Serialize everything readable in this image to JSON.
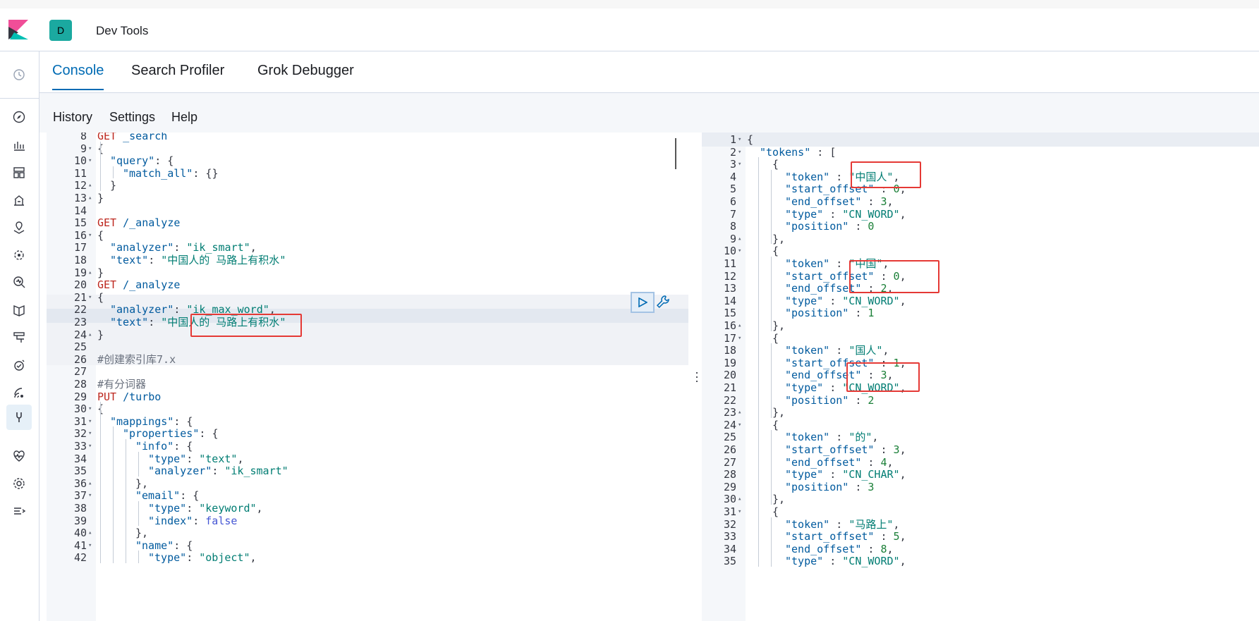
{
  "app": {
    "title": "Dev Tools",
    "space_initial": "D"
  },
  "tabs": [
    {
      "label": "Console",
      "active": true
    },
    {
      "label": "Search Profiler",
      "active": false
    },
    {
      "label": "Grok Debugger",
      "active": false
    }
  ],
  "menu": {
    "history": "History",
    "settings": "Settings",
    "help": "Help"
  },
  "sidebar_icons": [
    "clock-icon",
    "compass-icon",
    "visualize-icon",
    "dashboard-icon",
    "canvas-icon",
    "maps-icon",
    "ml-icon",
    "metrics-icon",
    "logs-icon",
    "apm-icon",
    "uptime-icon",
    "siem-icon",
    "dev-tools-icon",
    "monitoring-icon",
    "management-icon",
    "collapse-icon"
  ],
  "request_lines": [
    {
      "n": "8",
      "fold": "",
      "indent": 0,
      "text": "GET _search"
    },
    {
      "n": "9",
      "fold": "▾",
      "indent": 0,
      "text": "{"
    },
    {
      "n": "10",
      "fold": "▾",
      "indent": 1,
      "text": "\"query\": {"
    },
    {
      "n": "11",
      "fold": "",
      "indent": 2,
      "text": "\"match_all\": {}"
    },
    {
      "n": "12",
      "fold": "▴",
      "indent": 1,
      "text": "}"
    },
    {
      "n": "13",
      "fold": "▴",
      "indent": 0,
      "text": "}"
    },
    {
      "n": "14",
      "fold": "",
      "indent": 0,
      "text": ""
    },
    {
      "n": "15",
      "fold": "",
      "indent": 0,
      "text": "GET /_analyze"
    },
    {
      "n": "16",
      "fold": "▾",
      "indent": 0,
      "text": "{"
    },
    {
      "n": "17",
      "fold": "",
      "indent": 1,
      "text": "\"analyzer\": \"ik_smart\","
    },
    {
      "n": "18",
      "fold": "",
      "indent": 1,
      "text": "\"text\": \"中国人的 马路上有积水\""
    },
    {
      "n": "19",
      "fold": "▴",
      "indent": 0,
      "text": "}"
    },
    {
      "n": "20",
      "fold": "",
      "indent": 0,
      "text": "GET /_analyze"
    },
    {
      "n": "21",
      "fold": "▾",
      "indent": 0,
      "text": "{"
    },
    {
      "n": "22",
      "fold": "",
      "indent": 1,
      "text": "\"analyzer\": \"ik_max_word\","
    },
    {
      "n": "23",
      "fold": "",
      "indent": 1,
      "text": "\"text\": \"中国人的 马路上有积水\""
    },
    {
      "n": "24",
      "fold": "▴",
      "indent": 0,
      "text": "}"
    },
    {
      "n": "25",
      "fold": "",
      "indent": 0,
      "text": ""
    },
    {
      "n": "26",
      "fold": "",
      "indent": 0,
      "text": "#创建索引库7.x"
    },
    {
      "n": "27",
      "fold": "",
      "indent": 0,
      "text": ""
    },
    {
      "n": "28",
      "fold": "",
      "indent": 0,
      "text": "#有分词器"
    },
    {
      "n": "29",
      "fold": "",
      "indent": 0,
      "text": "PUT /turbo"
    },
    {
      "n": "30",
      "fold": "▾",
      "indent": 0,
      "text": "{"
    },
    {
      "n": "31",
      "fold": "▾",
      "indent": 1,
      "text": "\"mappings\": {"
    },
    {
      "n": "32",
      "fold": "▾",
      "indent": 2,
      "text": "\"properties\": {"
    },
    {
      "n": "33",
      "fold": "▾",
      "indent": 3,
      "text": "\"info\": {"
    },
    {
      "n": "34",
      "fold": "",
      "indent": 4,
      "text": "\"type\": \"text\","
    },
    {
      "n": "35",
      "fold": "",
      "indent": 4,
      "text": "\"analyzer\": \"ik_smart\""
    },
    {
      "n": "36",
      "fold": "▴",
      "indent": 3,
      "text": "},"
    },
    {
      "n": "37",
      "fold": "▾",
      "indent": 3,
      "text": "\"email\": {"
    },
    {
      "n": "38",
      "fold": "",
      "indent": 4,
      "text": "\"type\": \"keyword\","
    },
    {
      "n": "39",
      "fold": "",
      "indent": 4,
      "text": "\"index\": false"
    },
    {
      "n": "40",
      "fold": "▴",
      "indent": 3,
      "text": "},"
    },
    {
      "n": "41",
      "fold": "▾",
      "indent": 3,
      "text": "\"name\": {"
    },
    {
      "n": "42",
      "fold": "",
      "indent": 4,
      "text": "\"type\": \"object\","
    }
  ],
  "response_lines": [
    {
      "n": "1",
      "fold": "▾",
      "indent": 0,
      "text": "{"
    },
    {
      "n": "2",
      "fold": "▾",
      "indent": 1,
      "text": "\"tokens\" : ["
    },
    {
      "n": "3",
      "fold": "▾",
      "indent": 2,
      "text": "{"
    },
    {
      "n": "4",
      "fold": "",
      "indent": 3,
      "text": "\"token\" : \"中国人\","
    },
    {
      "n": "5",
      "fold": "",
      "indent": 3,
      "text": "\"start_offset\" : 0,"
    },
    {
      "n": "6",
      "fold": "",
      "indent": 3,
      "text": "\"end_offset\" : 3,"
    },
    {
      "n": "7",
      "fold": "",
      "indent": 3,
      "text": "\"type\" : \"CN_WORD\","
    },
    {
      "n": "8",
      "fold": "",
      "indent": 3,
      "text": "\"position\" : 0"
    },
    {
      "n": "9",
      "fold": "▴",
      "indent": 2,
      "text": "},"
    },
    {
      "n": "10",
      "fold": "▾",
      "indent": 2,
      "text": "{"
    },
    {
      "n": "11",
      "fold": "",
      "indent": 3,
      "text": "\"token\" : \"中国\","
    },
    {
      "n": "12",
      "fold": "",
      "indent": 3,
      "text": "\"start_offset\" : 0,"
    },
    {
      "n": "13",
      "fold": "",
      "indent": 3,
      "text": "\"end_offset\" : 2,"
    },
    {
      "n": "14",
      "fold": "",
      "indent": 3,
      "text": "\"type\" : \"CN_WORD\","
    },
    {
      "n": "15",
      "fold": "",
      "indent": 3,
      "text": "\"position\" : 1"
    },
    {
      "n": "16",
      "fold": "▴",
      "indent": 2,
      "text": "},"
    },
    {
      "n": "17",
      "fold": "▾",
      "indent": 2,
      "text": "{"
    },
    {
      "n": "18",
      "fold": "",
      "indent": 3,
      "text": "\"token\" : \"国人\","
    },
    {
      "n": "19",
      "fold": "",
      "indent": 3,
      "text": "\"start_offset\" : 1,"
    },
    {
      "n": "20",
      "fold": "",
      "indent": 3,
      "text": "\"end_offset\" : 3,"
    },
    {
      "n": "21",
      "fold": "",
      "indent": 3,
      "text": "\"type\" : \"CN_WORD\","
    },
    {
      "n": "22",
      "fold": "",
      "indent": 3,
      "text": "\"position\" : 2"
    },
    {
      "n": "23",
      "fold": "▴",
      "indent": 2,
      "text": "},"
    },
    {
      "n": "24",
      "fold": "▾",
      "indent": 2,
      "text": "{"
    },
    {
      "n": "25",
      "fold": "",
      "indent": 3,
      "text": "\"token\" : \"的\","
    },
    {
      "n": "26",
      "fold": "",
      "indent": 3,
      "text": "\"start_offset\" : 3,"
    },
    {
      "n": "27",
      "fold": "",
      "indent": 3,
      "text": "\"end_offset\" : 4,"
    },
    {
      "n": "28",
      "fold": "",
      "indent": 3,
      "text": "\"type\" : \"CN_CHAR\","
    },
    {
      "n": "29",
      "fold": "",
      "indent": 3,
      "text": "\"position\" : 3"
    },
    {
      "n": "30",
      "fold": "▴",
      "indent": 2,
      "text": "},"
    },
    {
      "n": "31",
      "fold": "▾",
      "indent": 2,
      "text": "{"
    },
    {
      "n": "32",
      "fold": "",
      "indent": 3,
      "text": "\"token\" : \"马路上\","
    },
    {
      "n": "33",
      "fold": "",
      "indent": 3,
      "text": "\"start_offset\" : 5,"
    },
    {
      "n": "34",
      "fold": "",
      "indent": 3,
      "text": "\"end_offset\" : 8,"
    },
    {
      "n": "35",
      "fold": "",
      "indent": 3,
      "text": "\"type\" : \"CN_WORD\","
    }
  ],
  "colors": {
    "accent": "#006bb4",
    "space_badge": "#1ba9a0",
    "annotation": "#e53935"
  }
}
